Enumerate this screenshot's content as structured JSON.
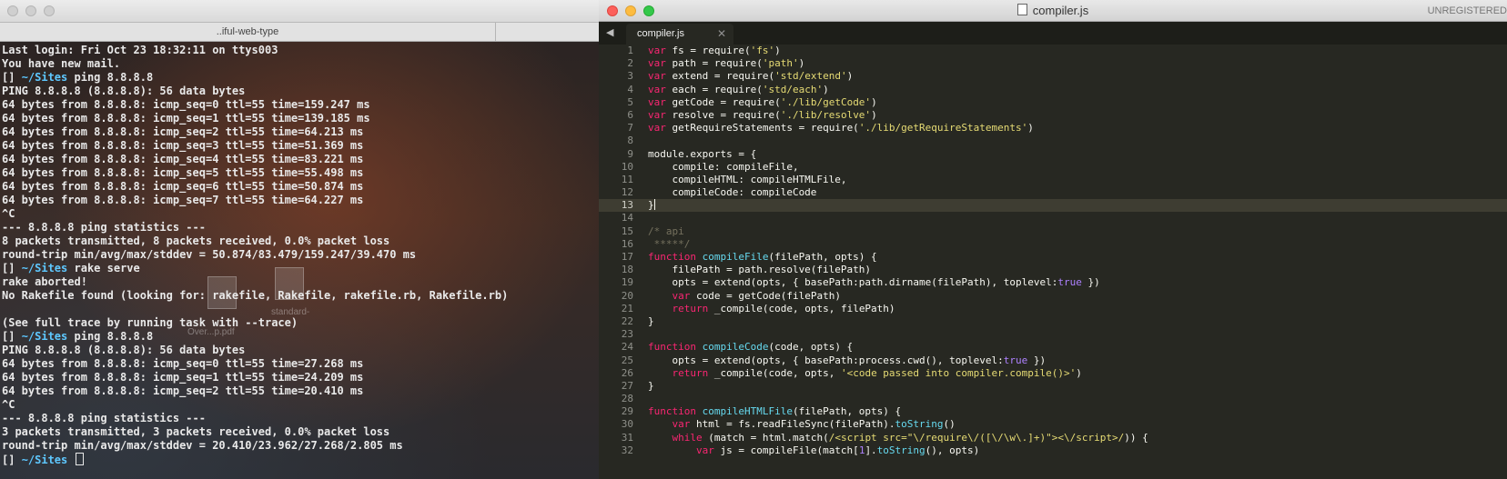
{
  "terminal": {
    "window_title": "..iful-web-type",
    "prompt_prefix": "[] ",
    "cwd": "~/Sites",
    "lines": [
      {
        "text": "Last login: Fri Oct 23 18:32:11 on ttys003"
      },
      {
        "text": "You have new mail."
      },
      {
        "cmd": "ping 8.8.8.8"
      },
      {
        "text": "PING 8.8.8.8 (8.8.8.8): 56 data bytes"
      },
      {
        "text": "64 bytes from 8.8.8.8: icmp_seq=0 ttl=55 time=159.247 ms"
      },
      {
        "text": "64 bytes from 8.8.8.8: icmp_seq=1 ttl=55 time=139.185 ms"
      },
      {
        "text": "64 bytes from 8.8.8.8: icmp_seq=2 ttl=55 time=64.213 ms"
      },
      {
        "text": "64 bytes from 8.8.8.8: icmp_seq=3 ttl=55 time=51.369 ms"
      },
      {
        "text": "64 bytes from 8.8.8.8: icmp_seq=4 ttl=55 time=83.221 ms"
      },
      {
        "text": "64 bytes from 8.8.8.8: icmp_seq=5 ttl=55 time=55.498 ms"
      },
      {
        "text": "64 bytes from 8.8.8.8: icmp_seq=6 ttl=55 time=50.874 ms"
      },
      {
        "text": "64 bytes from 8.8.8.8: icmp_seq=7 ttl=55 time=64.227 ms"
      },
      {
        "text": "^C"
      },
      {
        "text": "--- 8.8.8.8 ping statistics ---"
      },
      {
        "text": "8 packets transmitted, 8 packets received, 0.0% packet loss"
      },
      {
        "text": "round-trip min/avg/max/stddev = 50.874/83.479/159.247/39.470 ms"
      },
      {
        "cmd": "rake serve"
      },
      {
        "text": "rake aborted!"
      },
      {
        "text": "No Rakefile found (looking for: rakefile, Rakefile, rakefile.rb, Rakefile.rb)"
      },
      {
        "text": ""
      },
      {
        "text": "(See full trace by running task with --trace)"
      },
      {
        "cmd": "ping 8.8.8.8"
      },
      {
        "text": "PING 8.8.8.8 (8.8.8.8): 56 data bytes"
      },
      {
        "text": "64 bytes from 8.8.8.8: icmp_seq=0 ttl=55 time=27.268 ms"
      },
      {
        "text": "64 bytes from 8.8.8.8: icmp_seq=1 ttl=55 time=24.209 ms"
      },
      {
        "text": "64 bytes from 8.8.8.8: icmp_seq=2 ttl=55 time=20.410 ms"
      },
      {
        "text": "^C"
      },
      {
        "text": "--- 8.8.8.8 ping statistics ---"
      },
      {
        "text": "3 packets transmitted, 3 packets received, 0.0% packet loss"
      },
      {
        "text": "round-trip min/avg/max/stddev = 20.410/23.962/27.268/2.805 ms"
      },
      {
        "cmd": "",
        "cursor": true
      }
    ],
    "desktop_icons": [
      "standard-",
      "Over...p.pdf"
    ]
  },
  "editor": {
    "window_title": "compiler.js",
    "unregistered_label": "UNREGISTERED",
    "nav_arrows": "◀ ▶",
    "tab_label": "compiler.js",
    "tab_close": "✕",
    "active_line": 13,
    "lines": [
      [
        [
          "kw",
          "var"
        ],
        [
          "id",
          " fs = "
        ],
        [
          "id",
          "require("
        ],
        [
          "st",
          "'fs'"
        ],
        [
          "id",
          ")"
        ]
      ],
      [
        [
          "kw",
          "var"
        ],
        [
          "id",
          " path = "
        ],
        [
          "id",
          "require("
        ],
        [
          "st",
          "'path'"
        ],
        [
          "id",
          ")"
        ]
      ],
      [
        [
          "kw",
          "var"
        ],
        [
          "id",
          " extend = "
        ],
        [
          "id",
          "require("
        ],
        [
          "st",
          "'std/extend'"
        ],
        [
          "id",
          ")"
        ]
      ],
      [
        [
          "kw",
          "var"
        ],
        [
          "id",
          " each = "
        ],
        [
          "id",
          "require("
        ],
        [
          "st",
          "'std/each'"
        ],
        [
          "id",
          ")"
        ]
      ],
      [
        [
          "kw",
          "var"
        ],
        [
          "id",
          " getCode = "
        ],
        [
          "id",
          "require("
        ],
        [
          "st",
          "'./lib/getCode'"
        ],
        [
          "id",
          ")"
        ]
      ],
      [
        [
          "kw",
          "var"
        ],
        [
          "id",
          " resolve = "
        ],
        [
          "id",
          "require("
        ],
        [
          "st",
          "'./lib/resolve'"
        ],
        [
          "id",
          ")"
        ]
      ],
      [
        [
          "kw",
          "var"
        ],
        [
          "id",
          " getRequireStatements = "
        ],
        [
          "id",
          "require("
        ],
        [
          "st",
          "'./lib/getRequireStatements'"
        ],
        [
          "id",
          ")"
        ]
      ],
      [],
      [
        [
          "id",
          "module.exports = {"
        ]
      ],
      [
        [
          "id",
          "    compile: compileFile,"
        ]
      ],
      [
        [
          "id",
          "    compileHTML: compileHTMLFile,"
        ]
      ],
      [
        [
          "id",
          "    compileCode: compileCode"
        ]
      ],
      [
        [
          "id",
          "}"
        ],
        [
          "caret",
          ""
        ]
      ],
      [],
      [
        [
          "cm",
          "/* api"
        ]
      ],
      [
        [
          "cm",
          " *****/"
        ]
      ],
      [
        [
          "kw",
          "function"
        ],
        [
          "id",
          " "
        ],
        [
          "fn",
          "compileFile"
        ],
        [
          "id",
          "(filePath, opts) {"
        ]
      ],
      [
        [
          "id",
          "    filePath = path.resolve(filePath)"
        ]
      ],
      [
        [
          "id",
          "    opts = extend(opts, { basePath:path.dirname(filePath), toplevel:"
        ],
        [
          "bo",
          "true"
        ],
        [
          "id",
          " })"
        ]
      ],
      [
        [
          "id",
          "    "
        ],
        [
          "kw",
          "var"
        ],
        [
          "id",
          " code = getCode(filePath)"
        ]
      ],
      [
        [
          "id",
          "    "
        ],
        [
          "kw",
          "return"
        ],
        [
          "id",
          " _compile(code, opts, filePath)"
        ]
      ],
      [
        [
          "id",
          "}"
        ]
      ],
      [],
      [
        [
          "kw",
          "function"
        ],
        [
          "id",
          " "
        ],
        [
          "fn",
          "compileCode"
        ],
        [
          "id",
          "(code, opts) {"
        ]
      ],
      [
        [
          "id",
          "    opts = extend(opts, { basePath:process.cwd(), toplevel:"
        ],
        [
          "bo",
          "true"
        ],
        [
          "id",
          " })"
        ]
      ],
      [
        [
          "id",
          "    "
        ],
        [
          "kw",
          "return"
        ],
        [
          "id",
          " _compile(code, opts, "
        ],
        [
          "st",
          "'<code passed into compiler.compile()>'"
        ],
        [
          "id",
          ")"
        ]
      ],
      [
        [
          "id",
          "}"
        ]
      ],
      [],
      [
        [
          "kw",
          "function"
        ],
        [
          "id",
          " "
        ],
        [
          "fn",
          "compileHTMLFile"
        ],
        [
          "id",
          "(filePath, opts) {"
        ]
      ],
      [
        [
          "id",
          "    "
        ],
        [
          "kw",
          "var"
        ],
        [
          "id",
          " html = fs.readFileSync(filePath)."
        ],
        [
          "sr",
          "toString"
        ],
        [
          "id",
          "()"
        ]
      ],
      [
        [
          "id",
          "    "
        ],
        [
          "kw",
          "while"
        ],
        [
          "id",
          " (match = html.match("
        ],
        [
          "rx",
          "/<script src=\"\\/require\\/([\\/\\w\\.]+)\"><\\/script>/"
        ],
        [
          "id",
          ")) {"
        ]
      ],
      [
        [
          "id",
          "        "
        ],
        [
          "kw",
          "var"
        ],
        [
          "id",
          " js = compileFile(match["
        ],
        [
          "nm",
          "1"
        ],
        [
          "id",
          "]."
        ],
        [
          "sr",
          "toString"
        ],
        [
          "id",
          "(), opts)"
        ]
      ]
    ]
  }
}
